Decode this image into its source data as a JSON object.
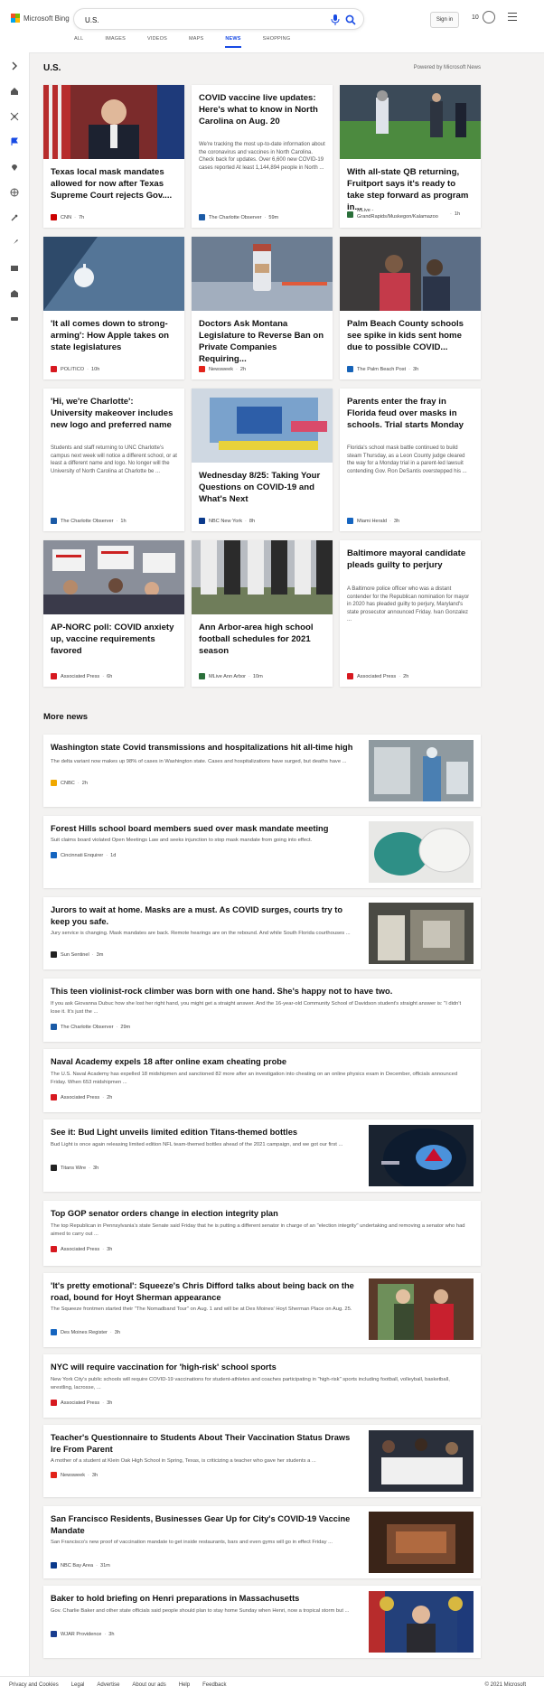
{
  "header": {
    "brand": "Microsoft Bing",
    "search_value": "U.S.",
    "signin_label": "Sign in",
    "rewards_count": "10",
    "tabs": [
      {
        "label": "ALL"
      },
      {
        "label": "IMAGES"
      },
      {
        "label": "VIDEOS"
      },
      {
        "label": "MAPS"
      },
      {
        "label": "NEWS"
      },
      {
        "label": "SHOPPING"
      }
    ],
    "active_tab": "NEWS"
  },
  "sidebar": {
    "icons": [
      "expand-icon",
      "home-icon",
      "science-icon",
      "flag-icon",
      "location-icon",
      "globe-icon",
      "tools-icon",
      "rocket-icon",
      "film-icon",
      "building-icon",
      "car-icon"
    ]
  },
  "main": {
    "section_title": "U.S.",
    "powered_by": "Powered by Microsoft News",
    "cards": [
      {
        "title": "Texas local mask mandates allowed for now after Texas Supreme Court rejects Gov....",
        "snippet": "",
        "source": "CNN",
        "time": "7h",
        "logo_color": "#cc0000"
      },
      {
        "title": "COVID vaccine live updates: Here's what to know in North Carolina on Aug. 20",
        "snippet": "We're tracking the most up-to-date information about the coronavirus and vaccines in North Carolina. Check back for updates. Over 6,600 new COVID-19 cases reported At least 1,144,894 people in North ...",
        "source": "The Charlotte Observer",
        "time": "59m",
        "logo_color": "#1a5aa6"
      },
      {
        "title": "With all-state QB returning, Fruitport says it's ready to take step forward as program in...",
        "snippet": "",
        "source": "MLive - GrandRapids/Muskegon/Kalamazoo",
        "time": "1h",
        "logo_color": "#2a6f3a"
      },
      {
        "title": "'It all comes down to strong-arming': How Apple takes on state legislatures",
        "snippet": "",
        "source": "POLITICO",
        "time": "10h",
        "logo_color": "#d71920"
      },
      {
        "title": "Doctors Ask Montana Legislature to Reverse Ban on Private Companies Requiring...",
        "snippet": "",
        "source": "Newsweek",
        "time": "2h",
        "logo_color": "#e2231a"
      },
      {
        "title": "Palm Beach County schools see spike in kids sent home due to possible COVID...",
        "snippet": "",
        "source": "The Palm Beach Post",
        "time": "3h",
        "logo_color": "#1663b8"
      },
      {
        "title": "'Hi, we're Charlotte': University makeover includes new logo and preferred name",
        "snippet": "Students and staff returning to UNC Charlotte's campus next week will notice a different school, or at least a different name and logo. No longer will the University of North Carolina at Charlotte be ...",
        "source": "The Charlotte Observer",
        "time": "1h",
        "logo_color": "#1a5aa6"
      },
      {
        "title": "Wednesday 8/25: Taking Your Questions on COVID-19 and What's Next",
        "snippet": "",
        "source": "NBC New York",
        "time": "8h",
        "logo_color": "#0b3a8c"
      },
      {
        "title": "Parents enter the fray in Florida feud over masks in schools. Trial starts Monday",
        "snippet": "Florida's school mask battle continued to build steam Thursday, as a Leon County judge cleared the way for a Monday trial in a parent-led lawsuit contending Gov. Ron DeSantis overstepped his ...",
        "source": "Miami Herald",
        "time": "3h",
        "logo_color": "#1565c0"
      },
      {
        "title": "AP-NORC poll: COVID anxiety up, vaccine requirements favored",
        "snippet": "",
        "source": "Associated Press",
        "time": "6h",
        "logo_color": "#d71920"
      },
      {
        "title": "Ann Arbor-area high school football schedules for 2021 season",
        "snippet": "",
        "source": "MLive Ann Arbor",
        "time": "10m",
        "logo_color": "#2a6f3a"
      },
      {
        "title": "Baltimore mayoral candidate pleads guilty to perjury",
        "snippet": "A Baltimore police officer who was a distant contender for the Republican nomination for mayor in 2020 has pleaded guilty to perjury, Maryland's state prosecutor announced Friday. Ivan Gonzalez ...",
        "source": "Associated Press",
        "time": "2h",
        "logo_color": "#d71920"
      }
    ],
    "more_news_title": "More news",
    "more_news": [
      {
        "title": "Washington state Covid transmissions and hospitalizations hit all-time high",
        "snippet": "The delta variant now makes up 98% of cases in Washington state. Cases and hospitalizations have surged, but deaths have ...",
        "source": "CNBC",
        "time": "2h",
        "logo_color": "#f0a800"
      },
      {
        "title": "Forest Hills school board members sued over mask mandate meeting",
        "snippet": "Suit claims board violated Open Meetings Law and seeks injunction to stop mask mandate from going into effect.",
        "source": "Cincinnati Enquirer",
        "time": "1d",
        "logo_color": "#1565c0"
      },
      {
        "title": "Jurors to wait at home. Masks are a must. As COVID surges, courts try to keep you safe.",
        "snippet": "Jury service is changing. Mask mandates are back. Remote hearings are on the rebound. And while South Florida courthouses ...",
        "source": "Sun Sentinel",
        "time": "3m",
        "logo_color": "#222222"
      },
      {
        "title": "This teen violinist-rock climber was born with one hand. She's happy not to have two.",
        "snippet": "If you ask Giovanna Dubuc how she lost her right hand, you might get a straight answer. And the 16-year-old Community School of Davidson student's straight answer is: \"I didn't lose it. It's just the ...",
        "source": "The Charlotte Observer",
        "time": "29m",
        "logo_color": "#1a5aa6"
      },
      {
        "title": "Naval Academy expels 18 after online exam cheating probe",
        "snippet": "The U.S. Naval Academy has expelled 18 midshipmen and sanctioned 82 more after an investigation into cheating on an online physics exam in December, officials announced Friday. When 653 midshipmen ...",
        "source": "Associated Press",
        "time": "2h",
        "logo_color": "#d71920"
      },
      {
        "title": "See it: Bud Light unveils limited edition Titans-themed bottles",
        "snippet": "Bud Light is once again releasing limited edition NFL team-themed bottles ahead of the 2021 campaign, and we got our first ...",
        "source": "Titans Wire",
        "time": "3h",
        "logo_color": "#222222"
      },
      {
        "title": "Top GOP senator orders change in election integrity plan",
        "snippet": "The top Republican in Pennsylvania's state Senate said Friday that he is putting a different senator in charge of an \"election integrity\" undertaking and removing a senator who had aimed to carry out ...",
        "source": "Associated Press",
        "time": "3h",
        "logo_color": "#d71920"
      },
      {
        "title": "'It's pretty emotional': Squeeze's Chris Difford talks about being back on the road, bound for Hoyt Sherman appearance",
        "snippet": "The Squeeze frontmen started their \"The Nomadband Tour\" on Aug. 1 and will be at Des Moines' Hoyt Sherman Place on Aug. 25.",
        "source": "Des Moines Register",
        "time": "3h",
        "logo_color": "#1565c0"
      },
      {
        "title": "NYC will require vaccination for 'high-risk' school sports",
        "snippet": "New York City's public schools will require COVID-19 vaccinations for student-athletes and coaches participating in \"high-risk\" sports including football, volleyball, basketball, wrestling, lacrosse, ...",
        "source": "Associated Press",
        "time": "3h",
        "logo_color": "#d71920"
      },
      {
        "title": "Teacher's Questionnaire to Students About Their Vaccination Status Draws Ire From Parent",
        "snippet": "A mother of a student at Klein Oak High School in Spring, Texas, is criticizing a teacher who gave her students a ...",
        "source": "Newsweek",
        "time": "3h",
        "logo_color": "#e2231a"
      },
      {
        "title": "San Francisco Residents, Businesses Gear Up for City's COVID-19 Vaccine Mandate",
        "snippet": "San Francisco's new proof of vaccination mandate to get inside restaurants, bars and even gyms will go in effect Friday ...",
        "source": "NBC Bay Area",
        "time": "31m",
        "logo_color": "#0b3a8c"
      },
      {
        "title": "Baker to hold briefing on Henri preparations in Massachusetts",
        "snippet": "Gov. Charlie Baker and other state officials said people should plan to stay home Sunday when Henri, now a tropical storm but ...",
        "source": "WJAR Providence",
        "time": "3h",
        "logo_color": "#1a3d8f"
      }
    ]
  },
  "footer": {
    "links": [
      "Privacy and Cookies",
      "Legal",
      "Advertise",
      "About our ads",
      "Help",
      "Feedback"
    ],
    "copyright": "© 2021 Microsoft"
  }
}
